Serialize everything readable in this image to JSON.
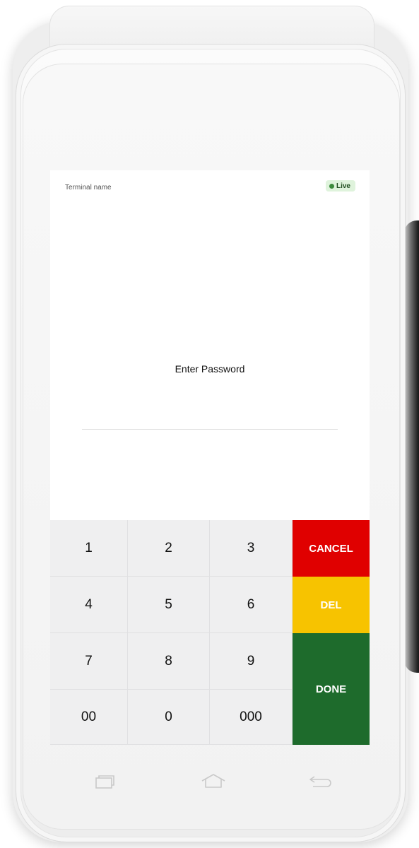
{
  "header": {
    "terminal_name": "Terminal name",
    "status_label": "Live",
    "status_color": "#dff3dc"
  },
  "prompt": {
    "text": "Enter Password"
  },
  "keypad": {
    "keys": [
      "1",
      "2",
      "3",
      "4",
      "5",
      "6",
      "7",
      "8",
      "9",
      "00",
      "0",
      "000"
    ],
    "cancel_label": "CANCEL",
    "delete_label": "DEL",
    "done_label": "DONE",
    "colors": {
      "cancel": "#e00000",
      "delete": "#f7c300",
      "done": "#1e6b2c"
    }
  },
  "navigation": {
    "icons": [
      "recent-apps-icon",
      "home-icon",
      "back-icon"
    ]
  }
}
